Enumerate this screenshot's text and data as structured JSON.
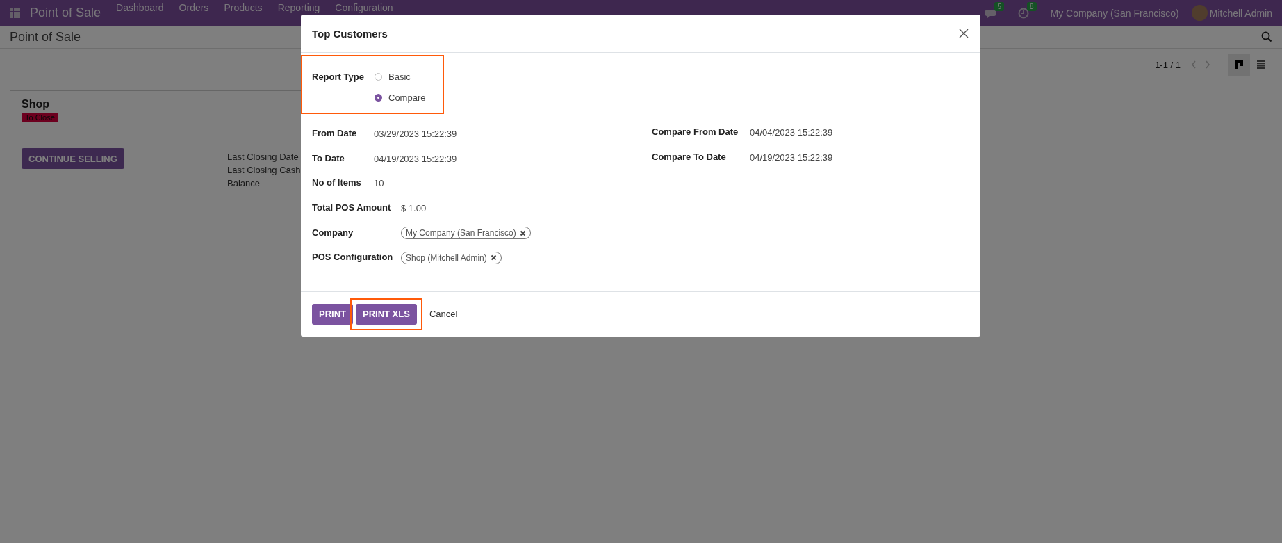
{
  "navbar": {
    "app_title": "Point of Sale",
    "menu": [
      "Dashboard",
      "Orders",
      "Products",
      "Reporting",
      "Configuration"
    ],
    "messages_badge": "5",
    "activities_badge": "8",
    "company": "My Company (San Francisco)",
    "user": "Mitchell Admin"
  },
  "control_panel": {
    "title": "Point of Sale",
    "pager": "1-1 / 1",
    "views": [
      {
        "kind": "kanban",
        "selected": true
      },
      {
        "kind": "list",
        "selected": false
      }
    ]
  },
  "kanban_cards": [
    {
      "title": "Shop",
      "status": "To Close",
      "button": "CONTINUE SELLING",
      "info_labels": [
        "Last Closing Date",
        "Last Closing Cash Balance"
      ]
    }
  ],
  "dialog": {
    "title": "Top Customers",
    "report_type": {
      "label": "Report Type",
      "highlighted": true,
      "options": [
        {
          "label": "Basic",
          "selected": false
        },
        {
          "label": "Compare",
          "selected": true
        }
      ]
    },
    "field_groups": [
      [
        {
          "label": "From Date",
          "kind": "text",
          "value": "03/29/2023 15:22:39"
        },
        {
          "label": "To Date",
          "kind": "text",
          "value": "04/19/2023 15:22:39"
        },
        {
          "label": "No of Items",
          "kind": "text",
          "value": "10"
        }
      ],
      [
        {
          "label": "Total POS Amount",
          "kind": "text",
          "value": "$ 1.00"
        },
        {
          "label": "Company",
          "kind": "tags",
          "tags": [
            "My Company (San Francisco)"
          ]
        },
        {
          "label": "POS Configuration",
          "kind": "tags",
          "tags": [
            "Shop (Mitchell Admin)"
          ]
        }
      ]
    ],
    "right_fields": [
      {
        "label": "Compare From Date",
        "kind": "text",
        "value": "04/04/2023 15:22:39"
      },
      {
        "label": "Compare To Date",
        "kind": "text",
        "value": "04/19/2023 15:22:39"
      }
    ],
    "buttons": [
      {
        "label": "PRINT",
        "kind": "primary",
        "highlighted": false
      },
      {
        "label": "PRINT XLS",
        "kind": "primary",
        "highlighted": true
      },
      {
        "label": "Cancel",
        "kind": "link",
        "highlighted": false
      }
    ]
  }
}
